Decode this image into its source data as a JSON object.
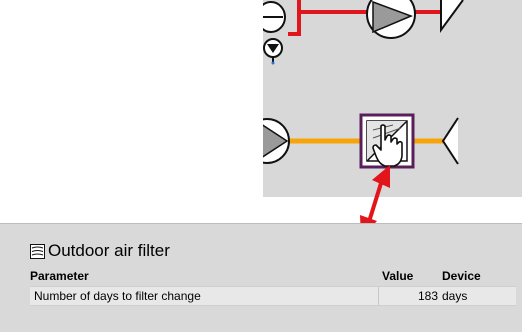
{
  "colors": {
    "return_duct": "#e0161d",
    "supply_duct": "#f7a30a",
    "selection_border": "#5a1f5a",
    "pointer_arrow": "#e2151b",
    "diagram_background": "#d8d8d8",
    "panel_background": "#d9d9d9"
  },
  "icons": {
    "component": "filter-icon",
    "cursor": "hand-pointer-icon",
    "fans": "fan-icon",
    "damper": "damper-icon",
    "duct_outlets": "duct-outlet-icon"
  },
  "panel": {
    "title": "Outdoor air filter",
    "header": {
      "parameter": "Parameter",
      "value": "Value",
      "device": "Device"
    },
    "rows": [
      {
        "parameter": "Number of days to filter change",
        "value": "183",
        "unit": "days"
      }
    ]
  }
}
